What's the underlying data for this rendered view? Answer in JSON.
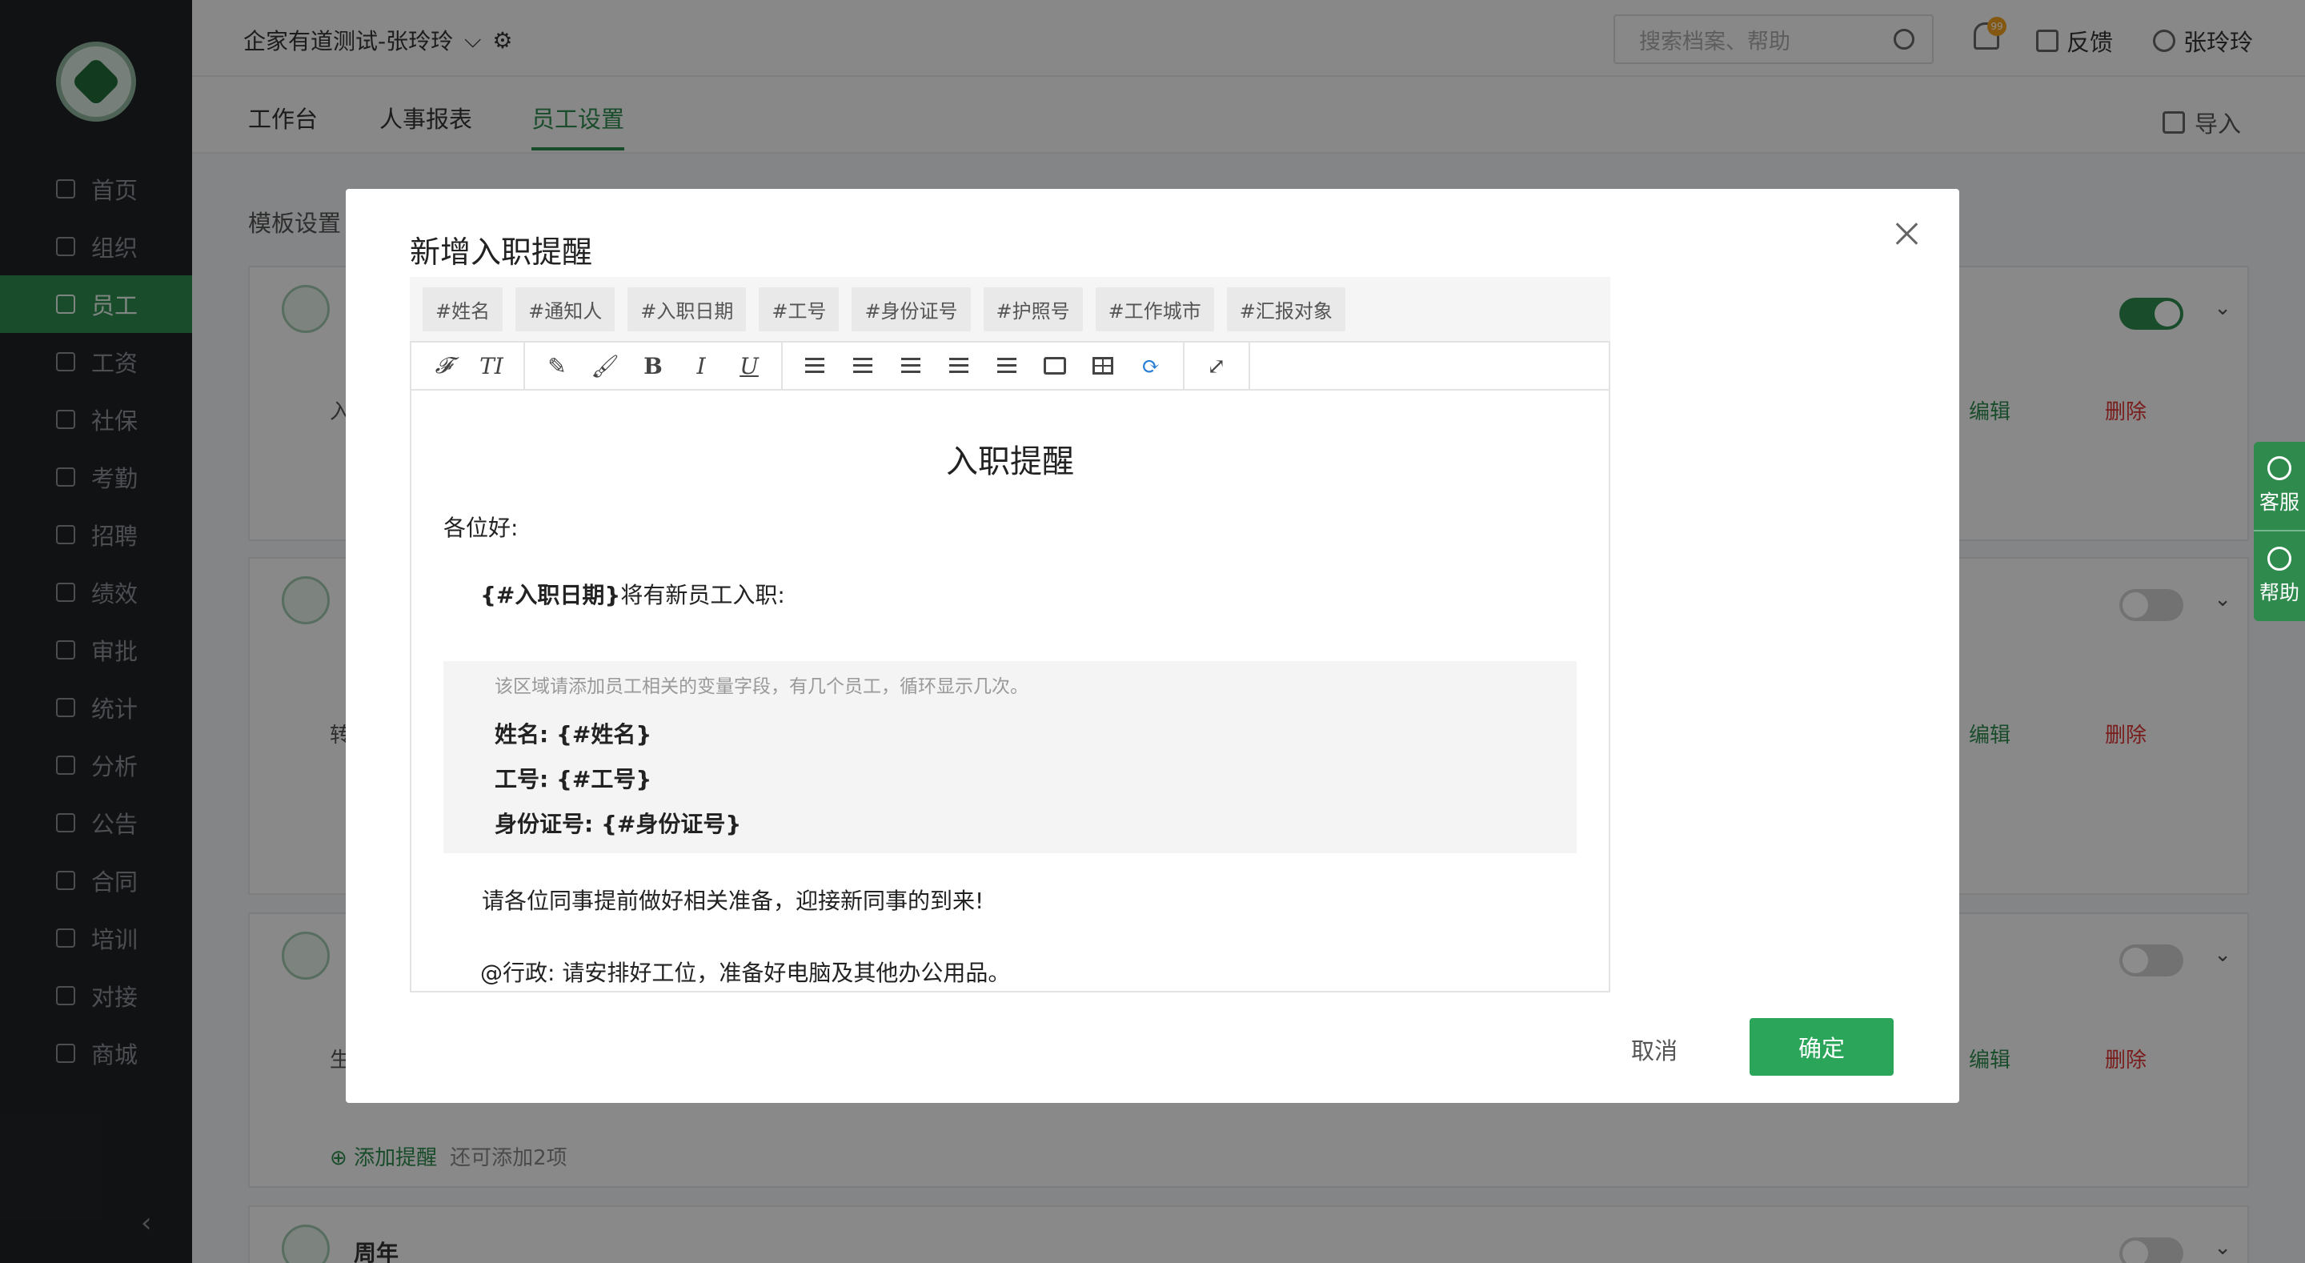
{
  "sidebar": {
    "items": [
      {
        "label": "首页"
      },
      {
        "label": "组织"
      },
      {
        "label": "员工"
      },
      {
        "label": "工资"
      },
      {
        "label": "社保"
      },
      {
        "label": "考勤"
      },
      {
        "label": "招聘"
      },
      {
        "label": "绩效"
      },
      {
        "label": "审批"
      },
      {
        "label": "统计"
      },
      {
        "label": "分析"
      },
      {
        "label": "公告"
      },
      {
        "label": "合同"
      },
      {
        "label": "培训"
      },
      {
        "label": "对接"
      },
      {
        "label": "商城"
      }
    ],
    "active_index": 2,
    "collapse_icon": "‹"
  },
  "header": {
    "org_name": "企家有道测试-张玲玲",
    "search_placeholder": "搜索档案、帮助",
    "notification_count": "99",
    "feedback": "反馈",
    "user_name": "张玲玲"
  },
  "tabs": {
    "items": [
      {
        "label": "工作台"
      },
      {
        "label": "人事报表"
      },
      {
        "label": "员工设置"
      }
    ],
    "active_index": 2,
    "import_label": "导入"
  },
  "content": {
    "section_title": "模板设置",
    "cards": [
      {
        "row_label": "入",
        "edit": "编辑",
        "delete": "删除",
        "toggle": "on"
      },
      {
        "row_label": "转",
        "edit": "编辑",
        "delete": "删除",
        "toggle": "off"
      },
      {
        "row_label": "生",
        "edit": "编辑",
        "delete": "删除",
        "toggle": "off",
        "add_label": "添加提醒",
        "add_hint": "还可添加2项"
      },
      {
        "name": "周年",
        "toggle": "off"
      }
    ]
  },
  "float_buttons": {
    "service": "客服",
    "help": "帮助"
  },
  "modal": {
    "title": "新增入职提醒",
    "variables": [
      "#姓名",
      "#通知人",
      "#入职日期",
      "#工号",
      "#身份证号",
      "#护照号",
      "#工作城市",
      "#汇报对象"
    ],
    "toolbar": {
      "font": "𝓕",
      "size": "TI",
      "bold": "B",
      "italic": "I",
      "underline": "U",
      "refresh": "⟳",
      "fullscreen": "⤢"
    },
    "doc": {
      "title": "入职提醒",
      "greeting": "各位好:",
      "line1_var": "{#入职日期}",
      "line1_text": "将有新员工入职:",
      "loop_hint": "该区域请添加员工相关的变量字段，有几个员工，循环显示几次。",
      "loop_rows": [
        "姓名: {#姓名}",
        "工号: {#工号}",
        "身份证号: {#身份证号}"
      ],
      "para": "请各位同事提前做好相关准备，迎接新同事的到来!",
      "para2": "@行政: 请安排好工位，准备好电脑及其他办公用品。"
    },
    "cancel": "取消",
    "confirm": "确定"
  },
  "colors": {
    "accent": "#2f8a4e",
    "confirm": "#2aa55a",
    "danger": "#d33"
  }
}
